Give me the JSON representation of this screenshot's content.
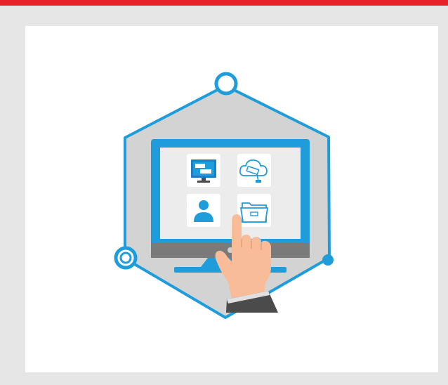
{
  "colors": {
    "accent_bar": "#e8202a",
    "page_background": "#e6e6e6",
    "card_background": "#ffffff",
    "hexagon_stroke": "#1f9ddb",
    "hexagon_fill": "#d3d3d4",
    "monitor_blue": "#1f9ddb",
    "screen_fill": "#ececec",
    "monitor_base": "#7a7a7a",
    "hand_skin": "#f8bd98",
    "sleeve": "#4b4b4b"
  },
  "icons": {
    "app_tiles": [
      "remote-desktop-icon",
      "cloud-camera-icon",
      "user-icon",
      "folder-icon"
    ],
    "connector_nodes": [
      "node-ring-icon",
      "node-ring-icon",
      "node-dot-icon"
    ],
    "hand": "pointing-hand-icon"
  }
}
